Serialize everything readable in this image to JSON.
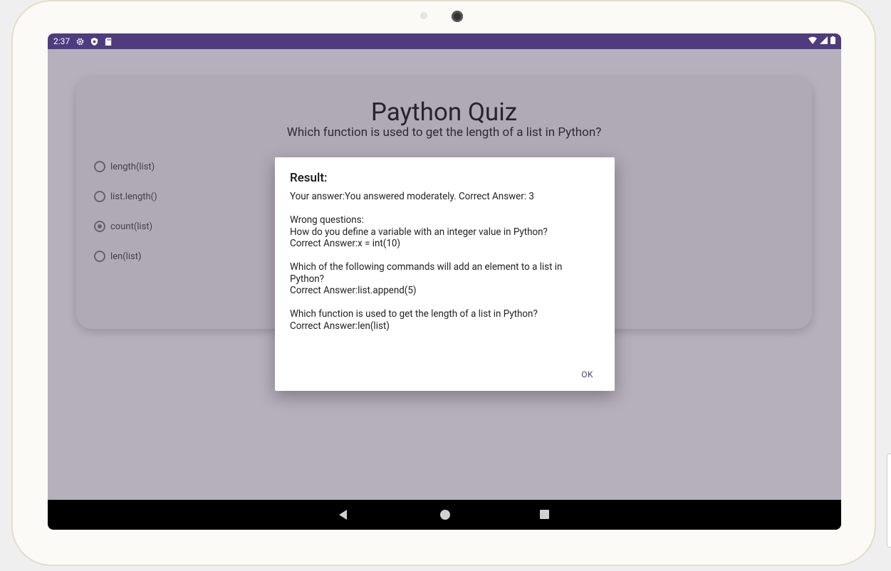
{
  "status_bar": {
    "time": "2:37",
    "left_icons": [
      "gear-icon",
      "shield-icon",
      "sd-card-icon"
    ],
    "right_icons": [
      "wifi-icon",
      "signal-icon",
      "battery-icon"
    ],
    "color": "#4f3b7e"
  },
  "quiz": {
    "title": "Paython Quiz",
    "question": "Which function is used to get the length of a list in Python?",
    "options": [
      {
        "label": "length(list)",
        "selected": false
      },
      {
        "label": "list.length()",
        "selected": false
      },
      {
        "label": "count(list)",
        "selected": true
      },
      {
        "label": "len(list)",
        "selected": false
      }
    ]
  },
  "dialog": {
    "title": "Result:",
    "summary": "Your answer:You answered moderately. Correct Answer: 3",
    "wrong_header": "Wrong questions:",
    "wrong": [
      {
        "question": "How do you define a variable with an integer value in Python?",
        "answer": "Correct Answer:x = int(10)"
      },
      {
        "question": "Which of the following commands will add an element to a list in Python?",
        "answer": "Correct Answer:list.append(5)"
      },
      {
        "question": "Which function is used to get the length of a list in Python?",
        "answer": "Correct Answer:len(list)"
      }
    ],
    "ok_label": "OK"
  },
  "nav_bar": {
    "buttons": [
      "back-icon",
      "home-icon",
      "recents-icon"
    ]
  }
}
